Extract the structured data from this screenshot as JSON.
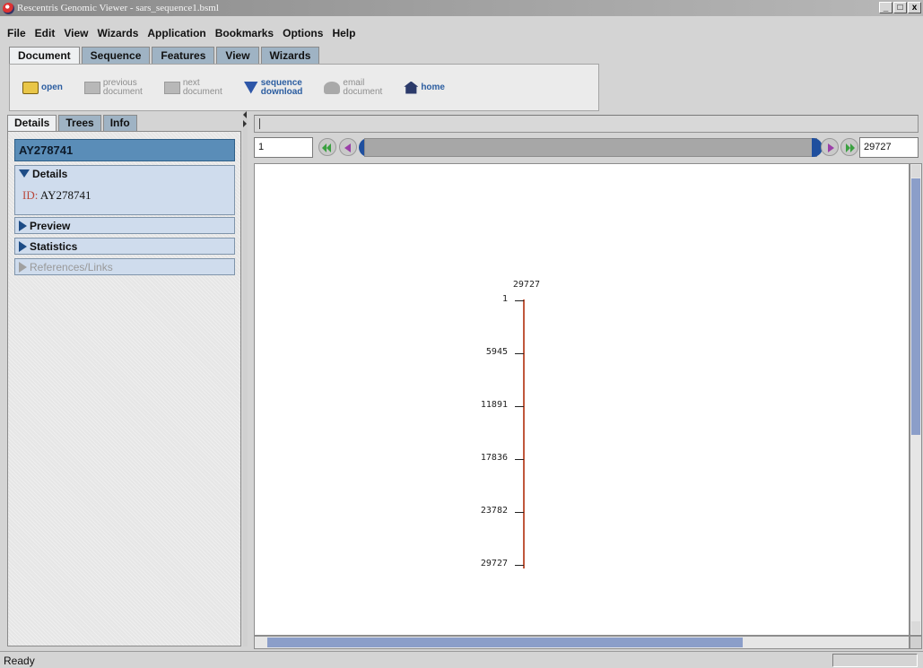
{
  "window": {
    "title": "Rescentris Genomic Viewer - sars_sequence1.bsml",
    "buttons": [
      "_",
      "&#8722;",
      "x"
    ]
  },
  "menu": [
    "File",
    "Edit",
    "View",
    "Wizards",
    "Application",
    "Bookmarks",
    "Options",
    "Help"
  ],
  "main_tabs": [
    {
      "label": "Document",
      "active": true
    },
    {
      "label": "Sequence",
      "active": false
    },
    {
      "label": "Features",
      "active": false
    },
    {
      "label": "View",
      "active": false
    },
    {
      "label": "Wizards",
      "active": false
    }
  ],
  "toolbar": {
    "open": "open",
    "previous": "previous\ndocument",
    "next": "next\ndocument",
    "download": "sequence\ndownload",
    "email": "email\ndocument",
    "home": "home"
  },
  "left_tabs": [
    "Details",
    "Trees",
    "Info"
  ],
  "left_panel": {
    "accession": "AY278741",
    "details_header": "Details",
    "id_label": "ID:",
    "id_value": "AY278741",
    "sections": [
      "Preview",
      "Statistics",
      "References/Links"
    ]
  },
  "navigator": {
    "start": "1",
    "end": "29727"
  },
  "ruler": {
    "top_label": "29727",
    "ticks": [
      "1",
      "5945",
      "11891",
      "17836",
      "23782",
      "29727"
    ]
  },
  "status": {
    "text": "Ready"
  }
}
